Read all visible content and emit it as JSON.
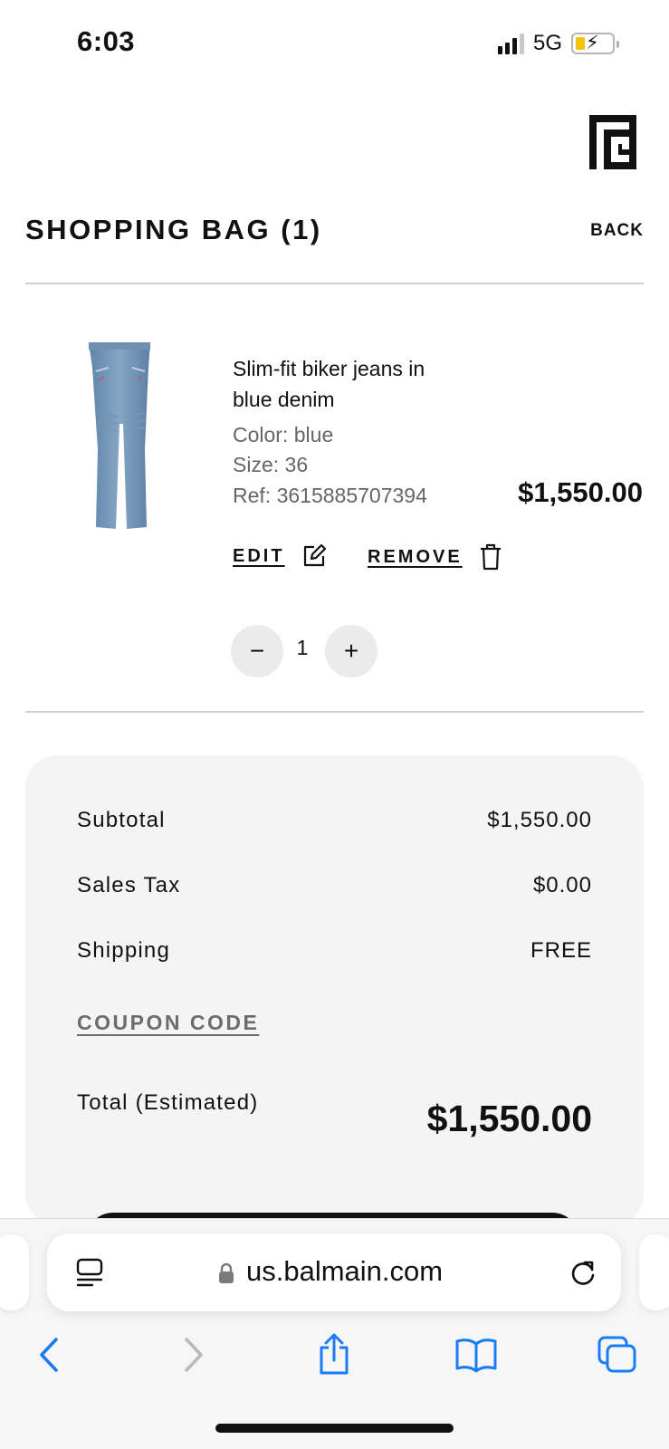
{
  "status_bar": {
    "time": "6:03",
    "network": "5G",
    "signal_bars_active": 3,
    "signal_bars_total": 4,
    "battery_state": "charging-low",
    "icons": [
      "signal-icon",
      "battery-charging-icon"
    ]
  },
  "header": {
    "logo_icon": "balmain-monogram-logo",
    "title": "SHOPPING BAG (1)",
    "back_label": "BACK"
  },
  "item": {
    "name": "Slim-fit biker jeans in blue denim",
    "color_label": "Color:",
    "color_value": "blue",
    "size_label": "Size:",
    "size_value": "36",
    "ref_label": "Ref:",
    "ref_value": "3615885707394",
    "price": "$1,550.00",
    "edit_label": "EDIT",
    "remove_label": "REMOVE",
    "quantity": "1",
    "icons": [
      "edit-icon",
      "trash-icon",
      "minus-icon",
      "plus-icon"
    ]
  },
  "summary": {
    "subtotal_label": "Subtotal",
    "subtotal_value": "$1,550.00",
    "tax_label": "Sales Tax",
    "tax_value": "$0.00",
    "shipping_label": "Shipping",
    "shipping_value": "FREE",
    "coupon_label": "COUPON CODE",
    "total_label": "Total (Estimated)",
    "total_value": "$1,550.00"
  },
  "browser": {
    "url": "us.balmain.com",
    "icons": [
      "reader-icon",
      "lock-icon",
      "reload-icon",
      "back-icon",
      "forward-icon",
      "share-icon",
      "bookmarks-icon",
      "tabs-icon"
    ],
    "forward_disabled": true
  },
  "colors": {
    "text": "#111111",
    "muted": "#666666",
    "summary_bg": "#f4f4f4",
    "safari_blue": "#1a7cf5",
    "divider": "#cfcfcf"
  }
}
